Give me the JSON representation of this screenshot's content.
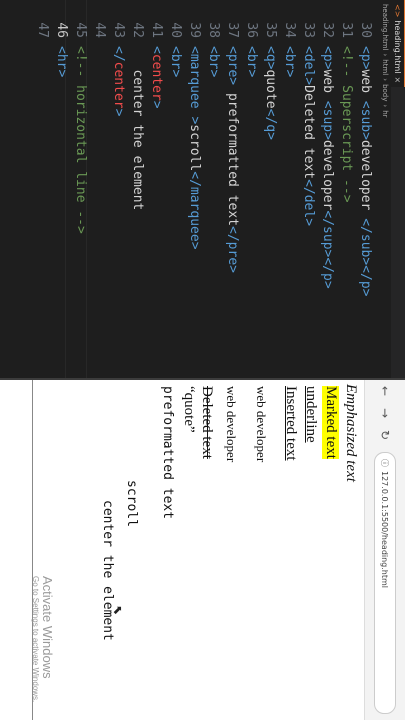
{
  "editor": {
    "tab_label": "heading.html",
    "tab_close": "×",
    "breadcrumb": [
      "heading.html",
      "html",
      "body",
      "hr"
    ],
    "line_numbers": [
      "30",
      "31",
      "32",
      "33",
      "34",
      "35",
      "36",
      "37",
      "38",
      "39",
      "40",
      "41",
      "42",
      "43",
      "44",
      "45",
      "46",
      "47"
    ],
    "active_line": "46"
  },
  "browser": {
    "url": "127.0.0.1:5500/heading.html",
    "page": {
      "emphasized": "Emphasized text",
      "marked": "Marked text",
      "underline": "underline",
      "inserted": "Inserted text",
      "sub_line": "web developer",
      "sup_line": "web developer",
      "deleted": "Deleted text",
      "quote": "“quote”",
      "pre": "preformatted text",
      "scroll": "scroll",
      "center": "center the element"
    },
    "watermark": {
      "title": "Activate Windows",
      "subtitle": "Go to Settings to activate Windows."
    }
  }
}
